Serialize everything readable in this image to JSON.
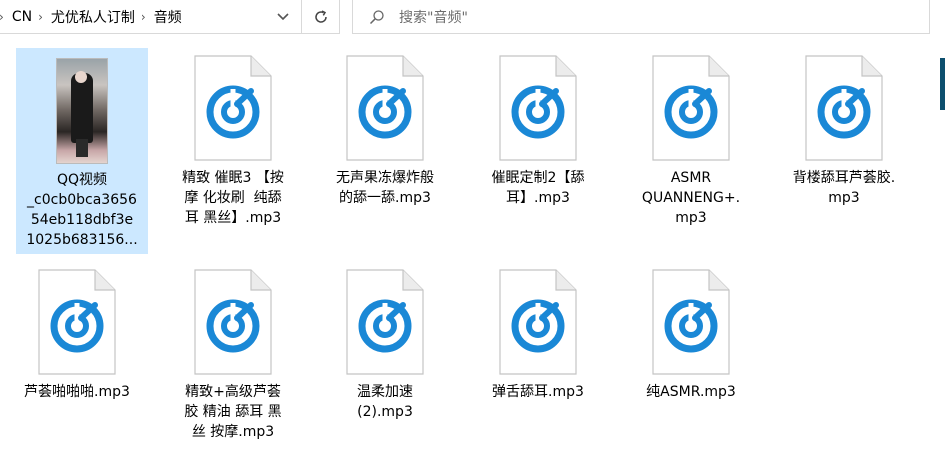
{
  "breadcrumb": {
    "leading_arrow": "›",
    "items": [
      "CN",
      "尤优私人订制",
      "音频"
    ],
    "separator": "›"
  },
  "search": {
    "placeholder": "搜索\"音频\""
  },
  "icons": {
    "dropdown": "chevron-down-icon",
    "refresh": "refresh-icon",
    "search": "search-icon",
    "audio": "audio-file-icon"
  },
  "colors": {
    "accent": "#1a88d6",
    "selection": "#cce8ff",
    "scroll_thumb": "#0d4f6e"
  },
  "files": [
    {
      "name": "QQ视频_c0cb0bca365654eb118dbf3e1025b683156...",
      "lines": [
        "QQ视频",
        "_c0cb0bca3656",
        "54eb118dbf3e",
        "1025b683156..."
      ],
      "kind": "video",
      "selected": true
    },
    {
      "name": "精致 催眠3 【按摩 化妆刷 纯舔耳 黑丝】.mp3",
      "lines": [
        "精致 催眠3 【按",
        "摩 化妆刷  纯舔",
        "耳 黑丝】.mp3"
      ],
      "kind": "audio"
    },
    {
      "name": "无声果冻爆炸般的舔一舔.mp3",
      "lines": [
        "无声果冻爆炸般",
        "的舔一舔.mp3"
      ],
      "kind": "audio"
    },
    {
      "name": "催眠定制2【舔耳】.mp3",
      "lines": [
        "催眠定制2【舔",
        "耳】.mp3"
      ],
      "kind": "audio"
    },
    {
      "name": "ASMR QUANNENG+.mp3",
      "lines": [
        "ASMR",
        "QUANNENG+.",
        "mp3"
      ],
      "kind": "audio"
    },
    {
      "name": "背楼舔耳芦荟胶.mp3",
      "lines": [
        "背楼舔耳芦荟胶.",
        "mp3"
      ],
      "kind": "audio"
    },
    {
      "name": "芦荟啪啪啪.mp3",
      "lines": [
        "芦荟啪啪啪.mp3"
      ],
      "kind": "audio"
    },
    {
      "name": "精致+高级芦荟胶 精油 舔耳 黑丝 按摩.mp3",
      "lines": [
        "精致+高级芦荟",
        "胶 精油 舔耳 黑",
        "丝 按摩.mp3"
      ],
      "kind": "audio"
    },
    {
      "name": "温柔加速(2).mp3",
      "lines": [
        "温柔加速",
        "(2).mp3"
      ],
      "kind": "audio"
    },
    {
      "name": "弹舌舔耳.mp3",
      "lines": [
        "弹舌舔耳.mp3"
      ],
      "kind": "audio"
    },
    {
      "name": "纯ASMR.mp3",
      "lines": [
        "纯ASMR.mp3"
      ],
      "kind": "audio"
    }
  ]
}
